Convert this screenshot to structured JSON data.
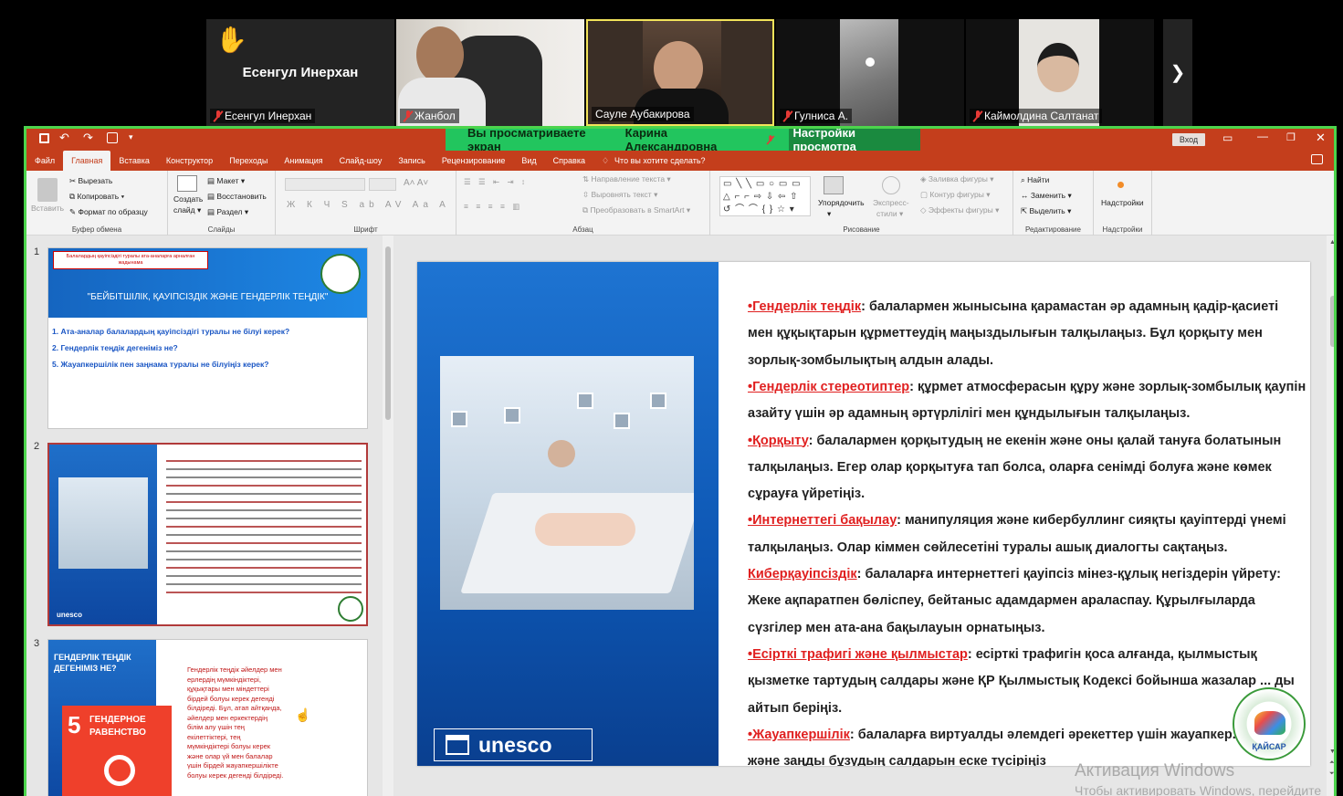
{
  "meeting": {
    "participants": [
      {
        "name": "Есенгул Инерхан",
        "tile_title": "Есенгул Инерхан",
        "raised_hand": true,
        "muted": true
      },
      {
        "name": "Жанбол",
        "muted": true
      },
      {
        "name": "Сауле Аубакирова",
        "muted": false,
        "active": true
      },
      {
        "name": "Гулниса А.",
        "muted": true
      },
      {
        "name": "Каймолдина Салтанат",
        "muted": true
      }
    ],
    "next_arrow": "❯",
    "share_banner": {
      "viewing_text": "Вы просматриваете экран",
      "presenter": "Карина Александровна",
      "view_settings": "Настройки просмотра"
    }
  },
  "ppt": {
    "title_button": "Вход",
    "menu": [
      "Файл",
      "Главная",
      "Вставка",
      "Конструктор",
      "Переходы",
      "Анимация",
      "Слайд-шоу",
      "Запись",
      "Рецензирование",
      "Вид",
      "Справка"
    ],
    "active_menu": "Главная",
    "tell_me": "Что вы хотите сделать?",
    "ribbon": {
      "clipboard": {
        "paste": "Вставить",
        "cut": "Вырезать",
        "copy": "Копировать",
        "format_painter": "Формат по образцу",
        "label": "Буфер обмена"
      },
      "slides": {
        "new_slide_1": "Создать",
        "new_slide_2": "слайд",
        "layout": "Макет",
        "reset": "Восстановить",
        "section": "Раздел",
        "label": "Слайды"
      },
      "font": {
        "label": "Шрифт"
      },
      "paragraph": {
        "text_direction": "Направление текста",
        "align_text": "Выровнять текст",
        "smartart": "Преобразовать в SmartArt",
        "label": "Абзац"
      },
      "drawing": {
        "arrange_1": "Упорядочить",
        "quick_styles_1": "Экспресс-",
        "quick_styles_2": "стили",
        "shape_fill": "Заливка фигуры",
        "shape_outline": "Контур фигуры",
        "shape_effects": "Эффекты фигуры",
        "label": "Рисование"
      },
      "editing": {
        "find": "Найти",
        "replace": "Заменить",
        "select": "Выделить",
        "label": "Редактирование"
      },
      "addins": {
        "button": "Надстройки",
        "label": "Надстройки"
      }
    },
    "thumbnails": [
      {
        "num": "1",
        "box_text": "Балалардың қауіпсіздігі туралы ата-аналарға арналған жадынама",
        "title": "\"БЕЙБІТШІЛІК, ҚАУІПСІЗДІК ЖӘНЕ ГЕНДЕРЛІК ТЕҢДІК\"",
        "items": [
          "1. Ата-аналар балалардың қауіпсіздігі туралы не білуі керек?",
          "2. Гендерлік теңдік дегеніміз не?",
          "5. Жауапкершілік пен заңнама туралы не білуіңіз керек?"
        ]
      },
      {
        "num": "2",
        "logo": "unesco"
      },
      {
        "num": "3",
        "heading_1": "ГЕНДЕРЛІК ТЕҢДІК",
        "heading_2": "ДЕГЕНІМІЗ НЕ?",
        "sdg_number": "5",
        "sdg_text_1": "ГЕНДЕРНОЕ",
        "sdg_text_2": "РАВЕНСТВО",
        "body": [
          "Гендерлік теңдік әйелдер мен",
          "ерлердің мүмкіндіктері,",
          "құқықтары мен міндеттері",
          "бірдей болуы керек дегенді",
          "білдіреді. Бұл, атап айтқанда,",
          "әйелдер мен еркектердің",
          "білім алу үшін тең",
          "екілеттіктері, тең",
          "мүмкіндіктері болуы керек",
          "және олар үй мен балалар",
          "үшін бірдей жауапкершілікте",
          "болуы керек дегенді білдіреді."
        ]
      }
    ],
    "slide": {
      "logo": "unesco",
      "kaisar_label": "ҚАЙСАР",
      "lines": [
        {
          "red": "•Гендерлік теңдік",
          "rest": ": балалармен жынысына қарамастан әр адамның қадір-қасиеті"
        },
        {
          "red": "",
          "rest": "мен құқықтарын құрметтеудің маңыздылығын талқылаңыз. Бұл қорқыту мен"
        },
        {
          "red": "",
          "rest": "зорлық-зомбылықтың алдын алады."
        },
        {
          "red": "•Гендерлік стереотиптер",
          "rest": ": құрмет атмосферасын құру және зорлық-зомбылық қаупін"
        },
        {
          "red": "",
          "rest": "азайту үшін әр адамның әртүрлілігі мен құндылығын талқылаңыз."
        },
        {
          "red": "•Қорқыту",
          "rest": ": балалармен қорқытудың не екенін және оны қалай тануға болатынын"
        },
        {
          "red": "",
          "rest": "талқылаңыз. Егер олар қорқытуға тап болса, оларға сенімді болуға және көмек"
        },
        {
          "red": "",
          "rest": "сұрауға үйретіңіз."
        },
        {
          "red": "•Интернеттегі бақылау",
          "rest": ": манипуляция және кибербуллинг сияқты қауіптерді үнемі"
        },
        {
          "red": "",
          "rest": "талқылаңыз. Олар кіммен сөйлесетіні туралы ашық диалогты сақтаңыз."
        },
        {
          "red": "Киберқауіпсіздік",
          "rest": ": балаларға интернеттегі қауіпсіз мінез-құлық негіздерін үйрету:"
        },
        {
          "red": "",
          "rest": "Жеке ақпаратпен бөліспеу, бейтаныс адамдармен араласпау. Құрылғыларда"
        },
        {
          "red": "",
          "rest": "сүзгілер мен ата-ана бақылауын орнатыңыз."
        },
        {
          "red": "•Есірткі трафигі және қылмыстар",
          "rest": ": есірткі трафигін қоса алғанда, қылмыстық"
        },
        {
          "red": "",
          "rest": "қызметке тартудың салдары және ҚР Қылмыстық Кодексі бойынша жазалар ... ды"
        },
        {
          "red": "",
          "rest": "айтып беріңіз."
        },
        {
          "red": "•Жауапкершілік",
          "rest": ": балаларға виртуалды әлемдегі әрекеттер үшін жауапкер..."
        },
        {
          "red": "",
          "rest": "және заңды бұзудың салдарын еске түсіріңіз"
        }
      ]
    }
  },
  "windows_watermark": {
    "line1": "Активация Windows",
    "line2": "Чтобы активировать Windows, перейдите"
  }
}
